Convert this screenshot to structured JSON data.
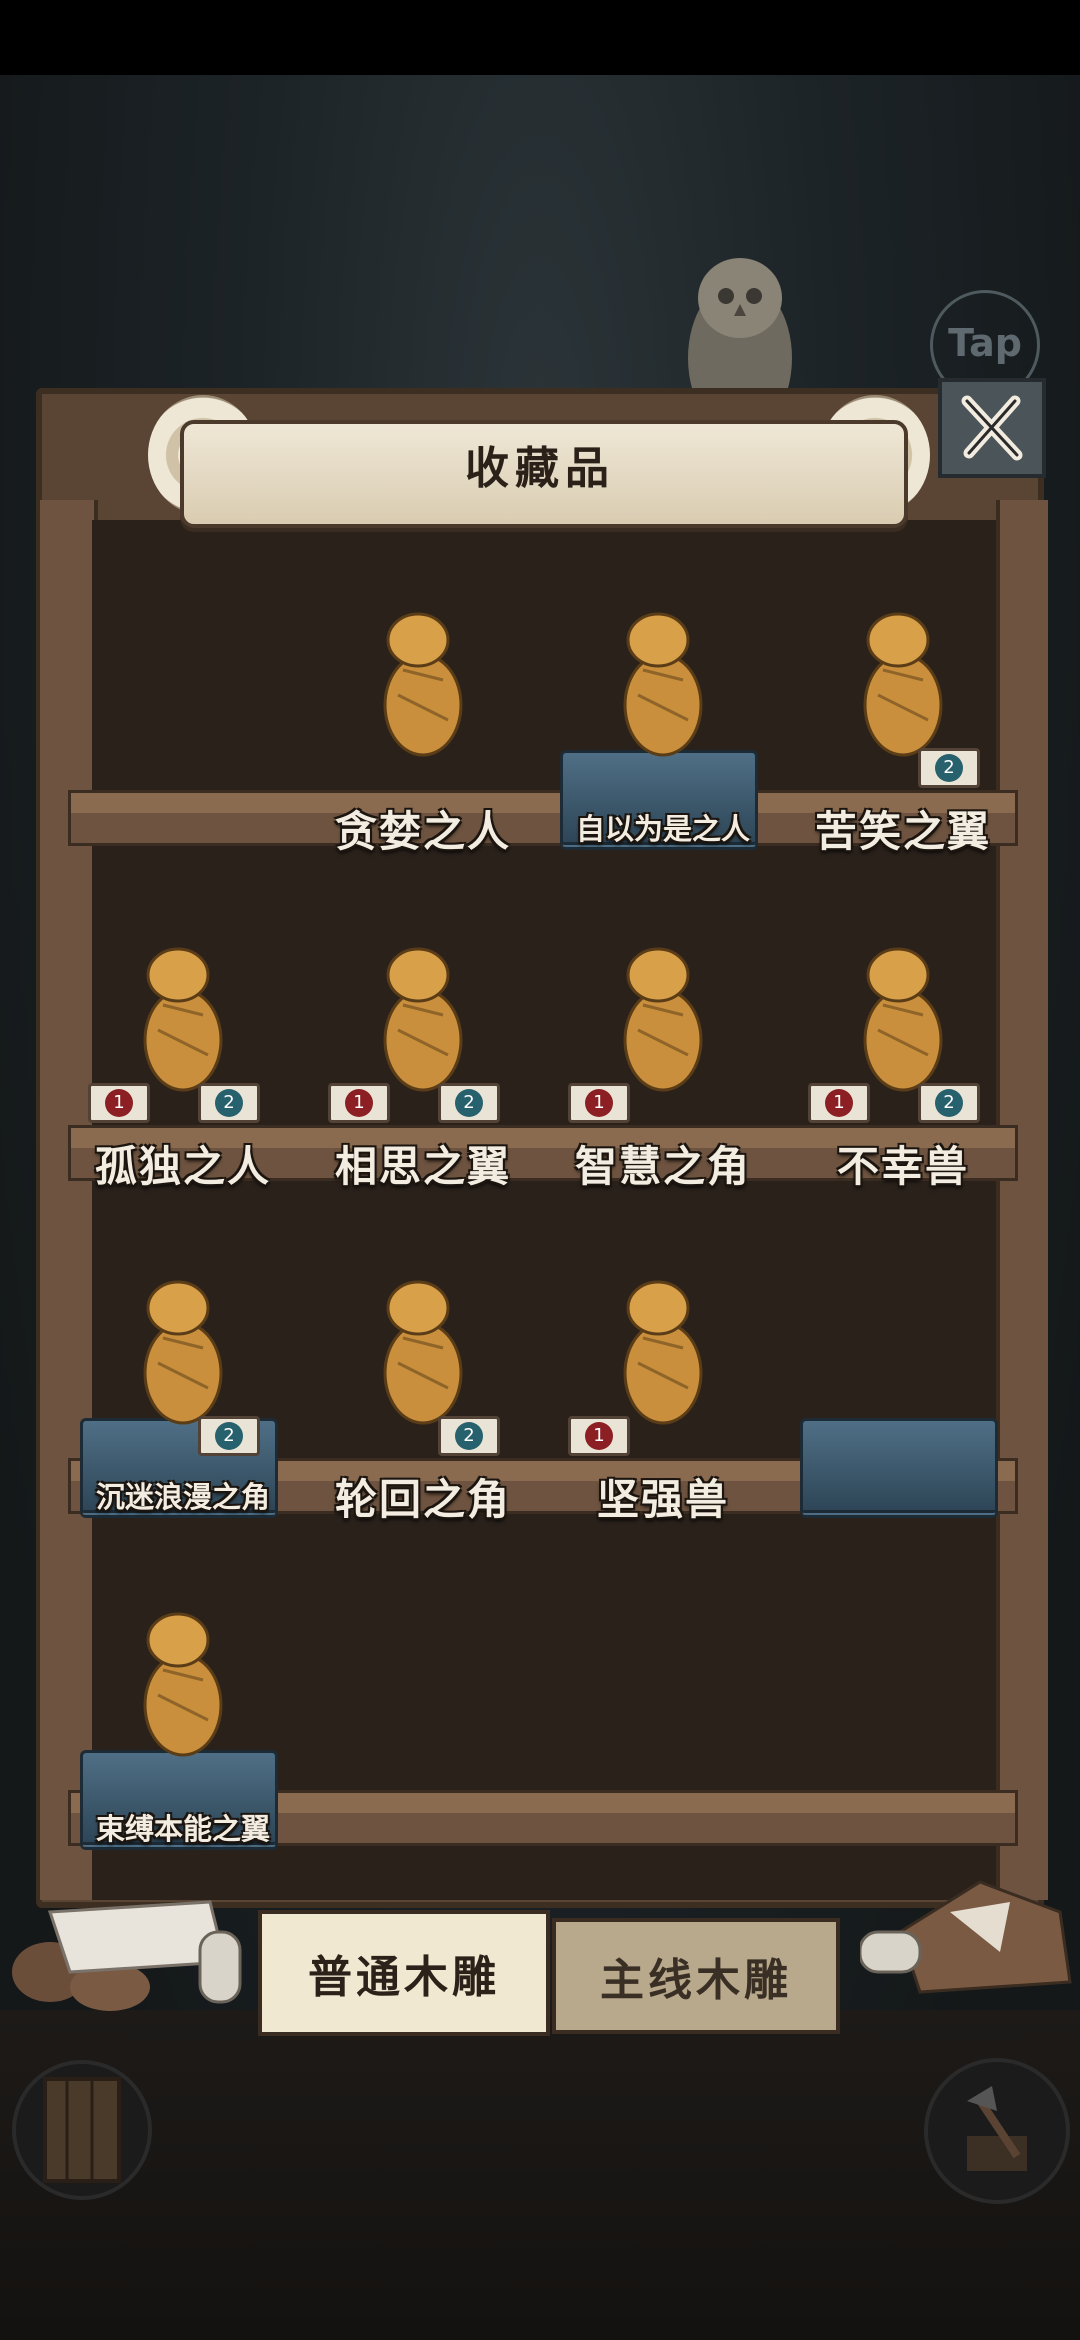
{
  "header": {
    "title": "收藏品",
    "tap_hint": "Tap",
    "close_icon": "close-x-icon"
  },
  "shelves": [
    {
      "items": [
        {
          "slot": 1,
          "label": "贪婪之人",
          "figure": "greedy-man-carving",
          "cloth": false,
          "badges": []
        },
        {
          "slot": 2,
          "label": "自以为是之人",
          "figure": "arrogant-man-carving",
          "cloth": true,
          "badges": []
        },
        {
          "slot": 3,
          "label": "苦笑之翼",
          "figure": "bird-carving",
          "cloth": false,
          "badges": [
            "2"
          ]
        }
      ]
    },
    {
      "items": [
        {
          "slot": 0,
          "label": "孤独之人",
          "figure": "lonely-girl-carving",
          "cloth": false,
          "badges": [
            "1",
            "2"
          ]
        },
        {
          "slot": 1,
          "label": "相思之翼",
          "figure": "crane-carving",
          "cloth": false,
          "badges": [
            "1",
            "2"
          ]
        },
        {
          "slot": 2,
          "label": "智慧之角",
          "figure": "turtle-carving",
          "cloth": false,
          "badges": [
            "1"
          ]
        },
        {
          "slot": 3,
          "label": "不幸兽",
          "figure": "bear-carving",
          "cloth": false,
          "badges": [
            "1",
            "2"
          ]
        }
      ]
    },
    {
      "items": [
        {
          "slot": 0,
          "label": "沉迷浪漫之角",
          "figure": "horned-fox-carving",
          "cloth": true,
          "badges": [
            "2"
          ]
        },
        {
          "slot": 1,
          "label": "轮回之角",
          "figure": "bull-carving",
          "cloth": false,
          "badges": [
            "2"
          ]
        },
        {
          "slot": 2,
          "label": "坚强兽",
          "figure": "strong-beast-carving",
          "cloth": false,
          "badges": [
            "1"
          ]
        },
        {
          "slot": 3,
          "label": "",
          "figure": "",
          "cloth": true,
          "badges": []
        }
      ]
    },
    {
      "items": [
        {
          "slot": 0,
          "label": "束缚本能之翼",
          "figure": "pelican-carving",
          "cloth": true,
          "badges": []
        }
      ]
    }
  ],
  "tabs": [
    {
      "label": "普通木雕",
      "active": true
    },
    {
      "label": "主线木雕",
      "active": false
    }
  ],
  "footer": {
    "left_icon": "door-icon",
    "right_icon": "axe-icon"
  },
  "colors": {
    "shelf_wood": "#8a6b50",
    "cloth_blue": "#4f6f86",
    "badge_red": "#8c1f23",
    "badge_teal": "#27616d",
    "label_text": "#f3ede1"
  }
}
